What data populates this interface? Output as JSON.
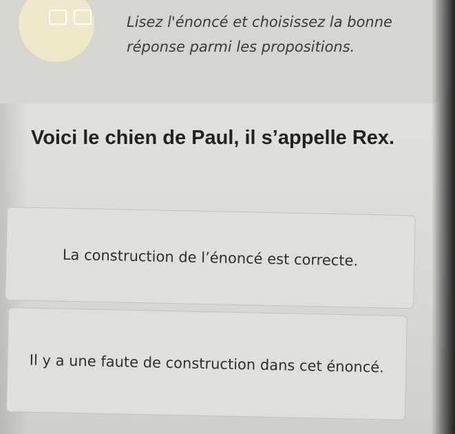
{
  "header": {
    "icon": "grid-tiles-icon",
    "instruction": "Lisez l'énoncé et choisissez la bonne réponse parmi les propositions."
  },
  "question": {
    "text": "Voici le chien de Paul, il s’appelle Rex."
  },
  "options": [
    {
      "label": "La construction de l’énoncé est correcte."
    },
    {
      "label": "Il y a une faute de construction dans cet énoncé."
    }
  ],
  "colors": {
    "page_background": "#dfded9",
    "icon_circle": "#f1e7cb",
    "option_border": "#c2c1bb"
  }
}
